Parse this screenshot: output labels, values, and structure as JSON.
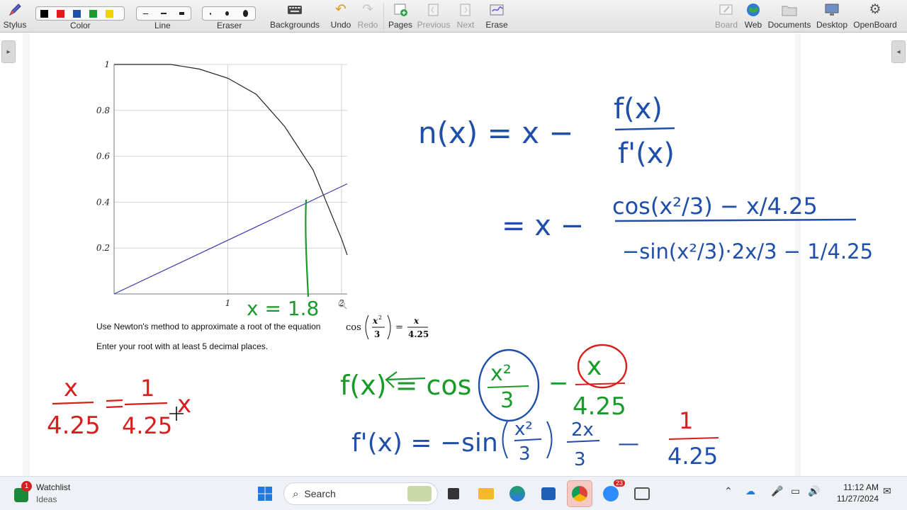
{
  "toolbar": {
    "stylus": "Stylus",
    "color": "Color",
    "line": "Line",
    "eraser": "Eraser",
    "backgrounds": "Backgrounds",
    "undo": "Undo",
    "redo": "Redo",
    "pages": "Pages",
    "previous": "Previous",
    "next": "Next",
    "erase": "Erase",
    "board": "Board",
    "web": "Web",
    "documents": "Documents",
    "desktop": "Desktop",
    "openboard": "OpenBoard",
    "palette_colors": [
      "#000000",
      "#e01b1b",
      "#1f4fa8",
      "#1a9a2a",
      "#f2d200"
    ],
    "icons": {
      "stylus": "pen-icon",
      "backgrounds": "keyboard-icon",
      "undo": "undo-icon",
      "redo": "redo-icon",
      "pages": "add-page-icon",
      "previous": "previous-page-icon",
      "next": "next-page-icon",
      "erase": "erase-icon",
      "board": "board-icon",
      "web": "globe-icon",
      "documents": "folder-icon",
      "desktop": "monitor-icon",
      "openboard": "settings-icon"
    }
  },
  "question": {
    "line1_prefix": "Use Newton's method to approximate a root of the equation",
    "eq_func": "cos",
    "eq_num": "x",
    "eq_exp": "2",
    "eq_den": "3",
    "eq_equals": "=",
    "eq_rhs_num": "x",
    "eq_rhs_den": "4.25",
    "line2": "Enter your root with at least 5 decimal places."
  },
  "chart_data": {
    "type": "line",
    "x_ticks": [
      "1",
      "2"
    ],
    "y_ticks": [
      "0.2",
      "0.4",
      "0.6",
      "0.8",
      "1"
    ],
    "xlim": [
      0,
      2.05
    ],
    "ylim": [
      0,
      1
    ],
    "grid": true,
    "series": [
      {
        "curve": "cos(x^2/3)",
        "color": "#222222",
        "x": [
          0,
          0.25,
          0.5,
          0.75,
          1,
          1.25,
          1.5,
          1.75,
          2,
          2.05
        ],
        "y": [
          1,
          1,
          1,
          0.98,
          0.94,
          0.87,
          0.73,
          0.54,
          0.24,
          0.17
        ]
      },
      {
        "curve": "x/4.25",
        "color": "#3a3ab0",
        "x": [
          0,
          2.05
        ],
        "y": [
          0,
          0.48
        ]
      }
    ]
  },
  "ink": {
    "graph_note": "x = 1.8",
    "simplify_left_num": "x",
    "simplify_left_den": "4.25",
    "simplify_rhs_num": "1",
    "simplify_rhs_den": "4.25",
    "simplify_rhs_var": "x",
    "n_lhs": "n(x) = x −",
    "n_num": "f(x)",
    "n_den": "f'(x)",
    "n2_prefix": "= x −",
    "n2_num": "cos(x²/3) − x/4.25",
    "n2_den": "−sin(x²/3)·2x/3 − 1/4.25",
    "f_line": "f(x) = cos",
    "f_frac_num": "x²",
    "f_frac_den": "3",
    "f_minus": "−",
    "f_x": "x",
    "f_den": "4.25",
    "fp_line": "f'(x) = −sin",
    "fp_frac_num": "x²",
    "fp_frac_den": "3",
    "fp_mult_num": "2x",
    "fp_mult_den": "3",
    "fp_minus": "—",
    "fp_one": "1",
    "fp_den": "4.25"
  },
  "taskbar": {
    "widget_title": "Watchlist",
    "widget_subtitle": "Ideas",
    "widget_badge": "1",
    "search_placeholder": "Search",
    "zoom_badge": "23",
    "time": "11:12 AM",
    "date": "11/27/2024"
  }
}
